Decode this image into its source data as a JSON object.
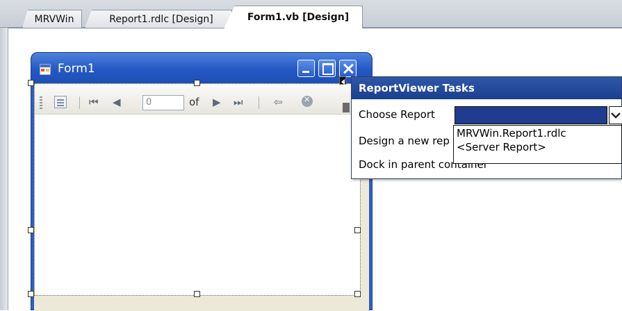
{
  "tabs": [
    {
      "label": "MRVWin",
      "active": false
    },
    {
      "label": "Report1.rdlc [Design]",
      "active": false
    },
    {
      "label": "Form1.vb [Design]",
      "active": true
    }
  ],
  "form": {
    "title": "Form1",
    "icon": "form-icon",
    "caption_buttons": [
      "minimize-icon",
      "maximize-icon",
      "close-icon"
    ]
  },
  "report_viewer": {
    "toolbar": {
      "page_value": "0",
      "of_label": "of",
      "icons": [
        "document-map-icon",
        "first-page-icon",
        "previous-page-icon",
        "next-page-icon",
        "last-page-icon",
        "back-icon",
        "stop-icon"
      ]
    }
  },
  "tasks_panel": {
    "title": "ReportViewer Tasks",
    "choose_report_label": "Choose Report",
    "design_new_label": "Design a new re",
    "design_new_tail": "p",
    "dock_label": "Dock in parent co",
    "dock_tail": "ntainer",
    "dropdown_items": [
      "MRVWin.Report1.rdlc",
      "<Server Report>"
    ]
  },
  "colors": {
    "title_bar": "#2458c4",
    "tasks_header": "#2e57a8",
    "combo_selected": "#1f3c8f"
  }
}
